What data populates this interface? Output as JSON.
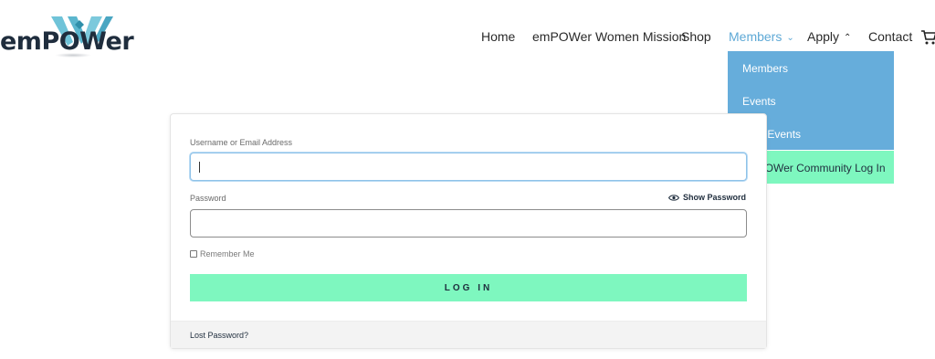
{
  "brand": {
    "logo_text": "emPOWer",
    "colors": {
      "teal": "#5bbcd3",
      "navy": "#1f2d3d",
      "mint": "#7ef7bf",
      "blue": "#66addb"
    }
  },
  "nav": {
    "items": [
      {
        "label": "Home"
      },
      {
        "label": "emPOWer Women Mission"
      },
      {
        "label": "Shop"
      },
      {
        "label": "Members",
        "caret": "⌄"
      },
      {
        "label": "Apply",
        "caret": "⌃"
      },
      {
        "label": "Contact"
      }
    ],
    "cart_icon": "cart-icon"
  },
  "dropdown": {
    "items": [
      {
        "label": "Members"
      },
      {
        "label": "Events"
      },
      {
        "label": "Past Events"
      },
      {
        "label": "emPOWer Community Log In"
      }
    ]
  },
  "login": {
    "username_label": "Username or Email Address",
    "username_value": "",
    "password_label": "Password",
    "password_value": "",
    "show_password_label": "Show Password",
    "remember_label": "Remember Me",
    "submit_label": "LOG IN",
    "lost_password_label": "Lost Password?"
  }
}
